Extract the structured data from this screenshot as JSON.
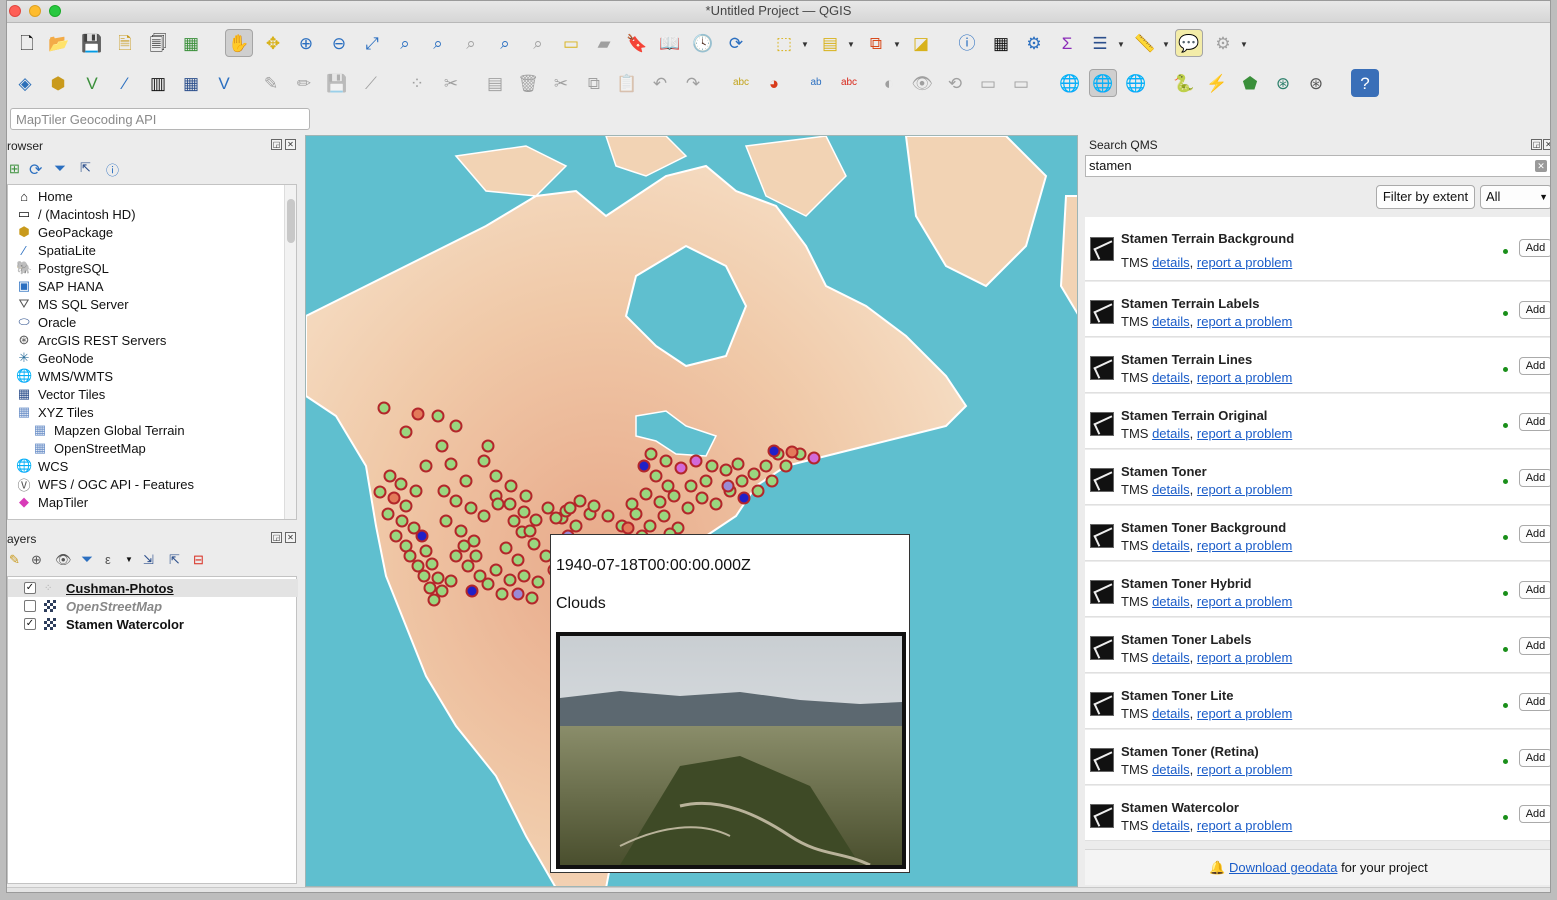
{
  "window": {
    "title": "*Untitled Project — QGIS"
  },
  "locator": {
    "placeholder": "MapTiler Geocoding API"
  },
  "browser": {
    "title": "rowser",
    "items": [
      {
        "label": "Home",
        "icon": "home-icon"
      },
      {
        "label": "/ (Macintosh HD)",
        "icon": "folder-icon"
      },
      {
        "label": "GeoPackage",
        "icon": "geopackage-icon"
      },
      {
        "label": "SpatiaLite",
        "icon": "spatialite-icon"
      },
      {
        "label": "PostgreSQL",
        "icon": "postgresql-icon"
      },
      {
        "label": "SAP HANA",
        "icon": "sap-hana-icon"
      },
      {
        "label": "MS SQL Server",
        "icon": "mssql-icon"
      },
      {
        "label": "Oracle",
        "icon": "oracle-icon"
      },
      {
        "label": "ArcGIS REST Servers",
        "icon": "arcgis-icon"
      },
      {
        "label": "GeoNode",
        "icon": "geonode-icon"
      },
      {
        "label": "WMS/WMTS",
        "icon": "globe-icon"
      },
      {
        "label": "Vector Tiles",
        "icon": "grid-icon"
      },
      {
        "label": "XYZ Tiles",
        "icon": "grid-icon"
      },
      {
        "label": "Mapzen Global Terrain",
        "icon": "grid-icon"
      },
      {
        "label": "OpenStreetMap",
        "icon": "grid-icon"
      },
      {
        "label": "WCS",
        "icon": "globe-icon"
      },
      {
        "label": "WFS / OGC API - Features",
        "icon": "wfs-icon"
      },
      {
        "label": "MapTiler",
        "icon": "maptiler-icon"
      }
    ]
  },
  "layers": {
    "title": "ayers",
    "items": [
      {
        "label": "Cushman-Photos",
        "checked": true
      },
      {
        "label": "OpenStreetMap",
        "checked": false
      },
      {
        "label": "Stamen Watercolor",
        "checked": true
      }
    ]
  },
  "popup": {
    "date": "1940-07-18T00:00:00.000Z",
    "caption": "Clouds"
  },
  "qms": {
    "title": "Search QMS",
    "search_value": "stamen",
    "filter_button": "Filter by extent",
    "scope_select": "All",
    "services": [
      {
        "name": "Stamen Terrain Background",
        "type": "TMS",
        "details": "details",
        "report": "report a problem",
        "add": "Add"
      },
      {
        "name": "Stamen Terrain Labels",
        "type": "TMS",
        "details": "details",
        "report": "report a problem",
        "add": "Add"
      },
      {
        "name": "Stamen Terrain Lines",
        "type": "TMS",
        "details": "details",
        "report": "report a problem",
        "add": "Add"
      },
      {
        "name": "Stamen Terrain Original",
        "type": "TMS",
        "details": "details",
        "report": "report a problem",
        "add": "Add"
      },
      {
        "name": "Stamen Toner",
        "type": "TMS",
        "details": "details",
        "report": "report a problem",
        "add": "Add"
      },
      {
        "name": "Stamen Toner Background",
        "type": "TMS",
        "details": "details",
        "report": "report a problem",
        "add": "Add"
      },
      {
        "name": "Stamen Toner Hybrid",
        "type": "TMS",
        "details": "details",
        "report": "report a problem",
        "add": "Add"
      },
      {
        "name": "Stamen Toner Labels",
        "type": "TMS",
        "details": "details",
        "report": "report a problem",
        "add": "Add"
      },
      {
        "name": "Stamen Toner Lite",
        "type": "TMS",
        "details": "details",
        "report": "report a problem",
        "add": "Add"
      },
      {
        "name": "Stamen Toner (Retina)",
        "type": "TMS",
        "details": "details",
        "report": "report a problem",
        "add": "Add"
      },
      {
        "name": "Stamen Watercolor",
        "type": "TMS",
        "details": "details",
        "report": "report a problem",
        "add": "Add"
      }
    ],
    "footer_link": "Download geodata",
    "footer_text": " for your project"
  },
  "toolbar1": [
    "new-project-icon",
    "open-project-icon",
    "save-project-icon",
    "new-print-layout-icon",
    "layout-manager-icon",
    "style-manager-icon",
    "pan-icon",
    "pan-to-selection-icon",
    "zoom-in-icon",
    "zoom-out-icon",
    "zoom-full-icon",
    "zoom-to-selection-icon",
    "zoom-to-layer-icon",
    "zoom-native-icon",
    "zoom-last-icon",
    "zoom-next-icon",
    "new-map-view-icon",
    "new-3d-view-icon",
    "new-bookmark-icon",
    "show-bookmarks-icon",
    "temporal-controller-icon",
    "refresh-icon",
    "select-features-icon",
    "select-by-value-icon",
    "deselect-icon",
    "select-location-icon",
    "identify-icon",
    "attribute-table-icon",
    "processing-toolbox-icon",
    "statistics-icon",
    "open-table-icon",
    "measure-icon",
    "map-tips-icon",
    "locate-icon"
  ],
  "colors": {
    "ocean": "#5fbfcf",
    "land": "#f2d3b4",
    "land_warm": "#e8a98a",
    "point_fill": "#9ad67f",
    "point_stroke": "#b3262a",
    "point_blue": "#2020c8",
    "point_magenta": "#d16ad9",
    "link": "#1a5cc8"
  }
}
